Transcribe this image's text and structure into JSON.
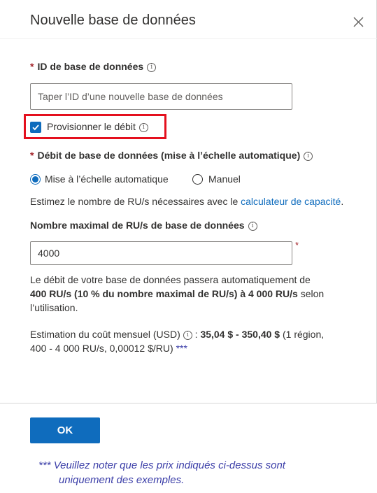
{
  "panel": {
    "title": "Nouvelle base de données"
  },
  "db_id": {
    "required_mark": "*",
    "label": "ID de base de données",
    "placeholder": "Taper l’ID d’une nouvelle base de données"
  },
  "provision": {
    "label": "Provisionner le débit",
    "checked": true
  },
  "throughput": {
    "required_mark": "*",
    "label": "Débit de base de données (mise à l’échelle automatique)",
    "option_auto": "Mise à l’échelle automatique",
    "option_manual": "Manuel",
    "estimate_prefix": "Estimez le nombre de RU/s nécessaires avec le ",
    "estimate_link": "calculateur de capacité",
    "estimate_suffix": "."
  },
  "max_ru": {
    "label": "Nombre maximal de RU/s de base de données",
    "value": "4000",
    "required_mark": "*"
  },
  "scale_info": {
    "line1": "Le débit de votre base de données passera automatiquement de",
    "bold": "400 RU/s (10 % du nombre maximal de RU/s) à 4 000 RU/s",
    "suffix": " selon",
    "line3": "l’utilisation."
  },
  "cost": {
    "prefix": "Estimation du coût mensuel (USD)",
    "colon": " : ",
    "range": "35,04 $ - 350,40 $",
    "detail1": " (1 région,",
    "detail2": "400 - 4 000 RU/s, 0,00012 $/RU) ",
    "stars": "***"
  },
  "footer": {
    "ok_label": "OK",
    "note_stars": "***",
    "note_text": "Veuillez noter que les prix indiqués ci-dessus sont",
    "note_text2": "uniquement des exemples."
  },
  "colors": {
    "accent": "#0f6cbd",
    "highlight": "#e4101e",
    "required": "#a4262c",
    "note": "#3b3ea8"
  },
  "icons": [
    "close-icon",
    "info-icon",
    "checkmark-icon"
  ]
}
